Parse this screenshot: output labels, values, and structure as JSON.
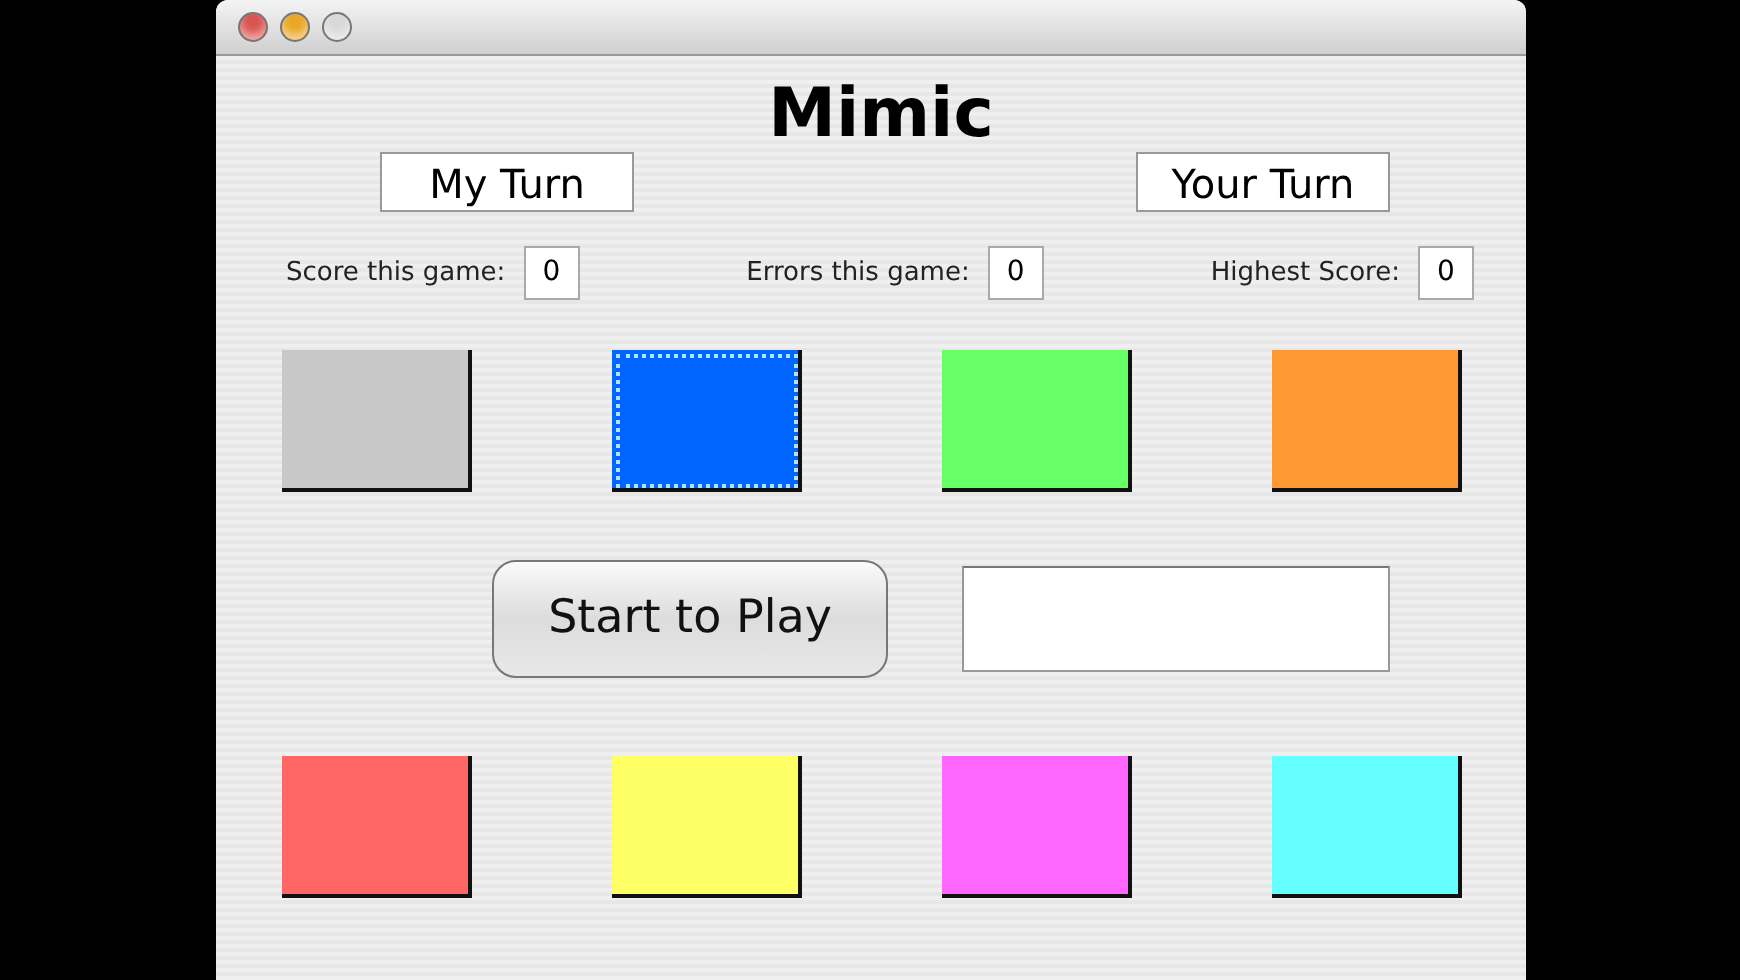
{
  "window": {
    "lights": [
      {
        "color": "#d9534f"
      },
      {
        "color": "#e8a623"
      },
      {
        "color": "#d8d8d8"
      }
    ]
  },
  "title": "Mimic",
  "turns": [
    {
      "label": "My Turn"
    },
    {
      "label": "Your Turn"
    }
  ],
  "scores": [
    {
      "label": "Score this game:",
      "value": "0"
    },
    {
      "label": "Errors this game:",
      "value": "0"
    },
    {
      "label": "Highest Score:",
      "value": "0"
    }
  ],
  "top_squares": [
    {
      "color": "#c8c8c8",
      "focused": false
    },
    {
      "color": "#0066ff",
      "focused": true
    },
    {
      "color": "#66ff66",
      "focused": false
    },
    {
      "color": "#ff9933",
      "focused": false
    }
  ],
  "start_button": {
    "label": "Start to Play"
  },
  "bottom_squares": [
    {
      "color": "#ff6666",
      "focused": false
    },
    {
      "color": "#ffff66",
      "focused": false
    },
    {
      "color": "#ff66ff",
      "focused": false
    },
    {
      "color": "#66ffff",
      "focused": false
    }
  ]
}
